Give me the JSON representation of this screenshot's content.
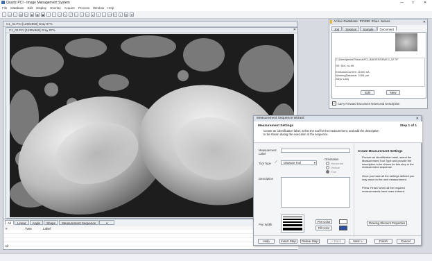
{
  "app": {
    "title": "Quartz PCI - Image Management System",
    "menu": [
      "File",
      "Database",
      "Edit",
      "Display",
      "Overlay",
      "Acquire",
      "Process",
      "Window",
      "Help"
    ],
    "window_controls": [
      "—",
      "□",
      "✕"
    ]
  },
  "image_window_back": {
    "title": "C1_01.PCI [1280x960] Gray 87%"
  },
  "image_window_front": {
    "title": "C1_02.PCI [1280x960] Gray 87%"
  },
  "bottom_panel": {
    "tabs": [
      "All",
      "Linear",
      "Angle",
      "Shape",
      "Measurement Sequence"
    ],
    "columns": [
      "#",
      "Type",
      "Label"
    ],
    "row_marker": "All"
  },
  "database_panel": {
    "title": "Active Database: PCIDB: Eben James",
    "tabs": [
      "Job",
      "Session",
      "Sample",
      "Document"
    ],
    "path": "C:\\Users\\james\\Pictures\\PCI_IMAGES\\SEM\\C1_02.TIF",
    "info_lines": [
      "SE: 5kV, no tilt",
      "EmissionCurrent: 11000 nA",
      "WorkingDistance: 1000 µm",
      "SE(U,LA0)"
    ],
    "edit_label": "Edit",
    "new_label": "New",
    "carry_forward": "Carry Forward Document Notes and Description"
  },
  "wizard": {
    "title": "Measurement Sequence Wizard",
    "heading": "Measurement Settings",
    "step": "Step 1 of 1",
    "description": "Create an identification label, select the tool for the measurement, and add the description to be shown during the execution of the sequence.",
    "measurement_label": "Measurement Label",
    "tool_type_label": "Tool Type",
    "tool_value": "Distance Tool",
    "orientation_label": "Orientation",
    "orientations": [
      "Horizontal",
      "Vertical",
      "Free"
    ],
    "description_label": "Description",
    "pen_width_label": "Pen Width",
    "pen_color_label": "Pen Color",
    "fill_color_label": "Fill Color",
    "right_heading": "Create Measurement Settings",
    "right_text_1": "Provide an identification label, select the Measurement Tool Type and provide the description to be shown for this step in the measurement sequence.",
    "right_text_2": "Once you have all the settings defined you may move to the next measurement.",
    "right_text_3": "Press 'Finish' when all the required measurements have been entered.",
    "drawing_props": "Drawing Element Properties",
    "buttons": {
      "help": "Help",
      "insert": "Insert Step",
      "delete": "Delete Step",
      "back": "< Back",
      "next": "Next >",
      "finish": "Finish",
      "cancel": "Cancel"
    }
  },
  "colors": {
    "accent": "#3b6fb6",
    "pen_color": "#ffffff",
    "fill_color": "#2d4fa0",
    "titlebar": "#dde3ea"
  }
}
